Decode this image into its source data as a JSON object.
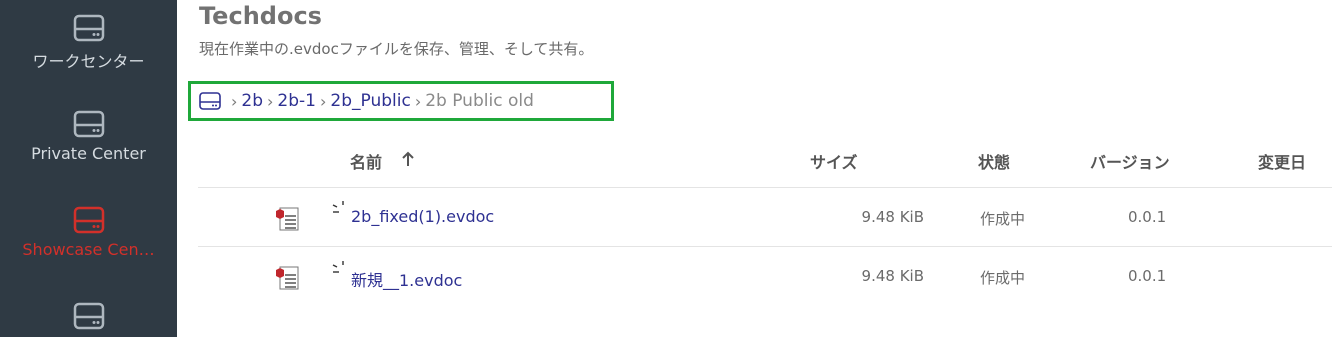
{
  "sidebar": {
    "items": [
      {
        "label": "ワークセンター",
        "icon": "drive-icon"
      },
      {
        "label": "Private Center",
        "icon": "drive-icon"
      },
      {
        "label": "Showcase Cen…",
        "icon": "drive-icon",
        "active": true
      },
      {
        "label": "",
        "icon": "drive-icon"
      }
    ]
  },
  "header": {
    "title": "Techdocs",
    "subtitle": "現在作業中の.evdocファイルを保存、管理、そして共有。"
  },
  "breadcrumb": {
    "home_icon": "drive-icon",
    "items": [
      "2b",
      "2b-1",
      "2b_Public",
      "2b Public old"
    ]
  },
  "table": {
    "headers": {
      "name": "名前",
      "size": "サイズ",
      "status": "状態",
      "version": "バージョン",
      "modified": "変更日"
    },
    "sort": "ascending",
    "rows": [
      {
        "name": "2b_fixed(1).evdoc",
        "size": "9.48 KiB",
        "status": "作成中",
        "version": "0.0.1"
      },
      {
        "name": "新規__1.evdoc",
        "size": "9.48 KiB",
        "status": "作成中",
        "version": "0.0.1"
      }
    ]
  },
  "colors": {
    "sidebar_bg": "#2f3a44",
    "accent_red": "#d2302a",
    "link": "#2e3192",
    "highlight": "#1fa83a"
  }
}
